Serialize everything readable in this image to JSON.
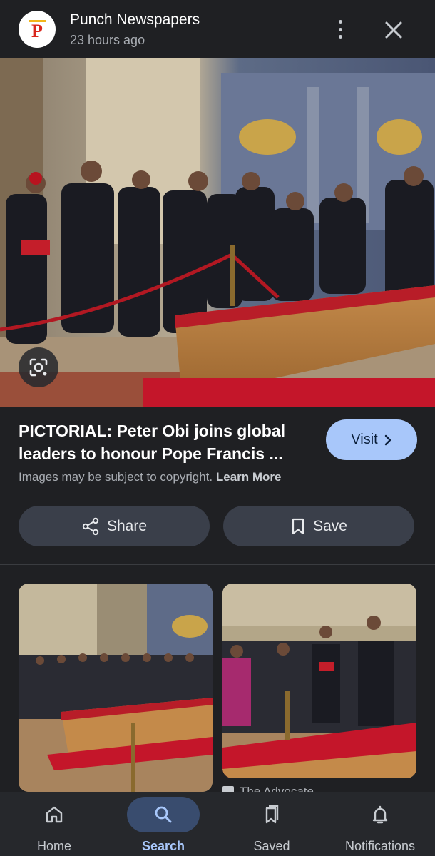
{
  "header": {
    "source_name": "Punch Newspapers",
    "time_ago": "23 hours ago",
    "logo_letter": "P"
  },
  "article": {
    "title": "PICTORIAL: Peter Obi joins global leaders to honour Pope Francis ...",
    "visit_label": "Visit",
    "copyright_text": "Images may be subject to copyright.",
    "learn_more_label": "Learn More"
  },
  "actions": {
    "share_label": "Share",
    "save_label": "Save"
  },
  "related": {
    "source_label": "The Advocate"
  },
  "bottom_nav": {
    "items": [
      {
        "label": "Home",
        "icon": "home-icon"
      },
      {
        "label": "Search",
        "icon": "search-icon",
        "active": true
      },
      {
        "label": "Saved",
        "icon": "saved-icon"
      },
      {
        "label": "Notifications",
        "icon": "bell-icon"
      }
    ]
  },
  "colors": {
    "background": "#1f2023",
    "accent": "#a8c7fa",
    "pill": "#3a3f4a",
    "nav_active": "#394c6e"
  }
}
